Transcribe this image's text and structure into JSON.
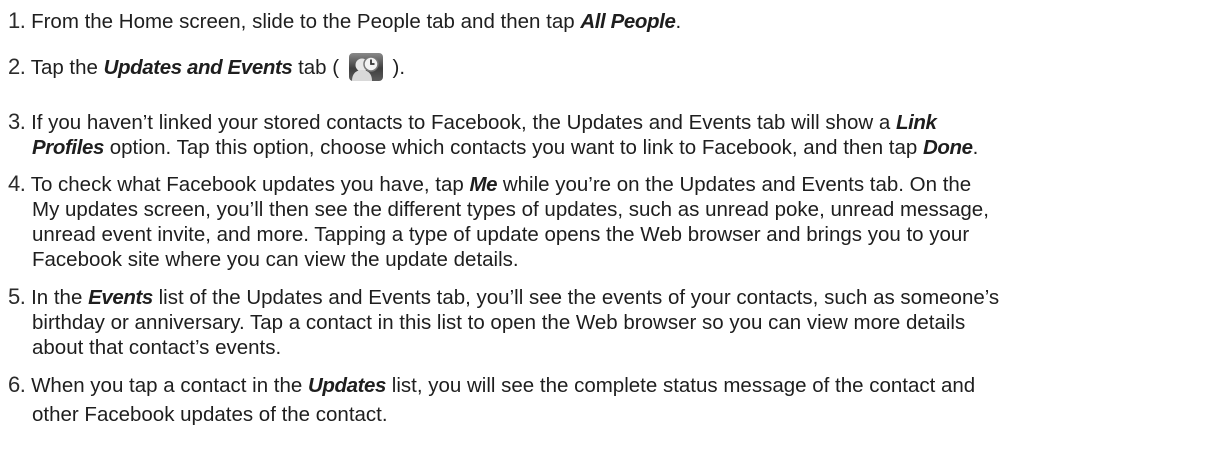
{
  "steps": [
    {
      "number": "1.",
      "parts": [
        "From the Home screen, slide to the People tab and then tap ",
        "All People",
        "."
      ]
    },
    {
      "number": "2.",
      "parts": [
        "Tap the ",
        "Updates and Events",
        " tab ( ",
        " )."
      ],
      "icon": "updates-events-tab-icon"
    },
    {
      "number": "3.",
      "lines": [
        [
          "If you haven’t linked your stored contacts to Facebook, the Updates and Events tab will show a ",
          "Link"
        ],
        [
          "Profiles",
          " option. Tap this option, choose which contacts you want to link to Facebook, and then tap ",
          "Done",
          "."
        ]
      ]
    },
    {
      "number": "4.",
      "lines": [
        [
          "To check what Facebook updates you have, tap ",
          "Me",
          " while you’re on the Updates and Events tab. On the"
        ],
        [
          "My updates screen, you’ll then see the different types of updates, such as unread poke, unread message,"
        ],
        [
          "unread event invite, and more. Tapping a type of update opens the Web browser and brings you to your"
        ],
        [
          "Facebook site where you can view the update details."
        ]
      ]
    },
    {
      "number": "5.",
      "lines": [
        [
          "In the ",
          "Events",
          " list of the Updates and Events tab, you’ll see the events of your contacts, such as someone’s"
        ],
        [
          "birthday or anniversary. Tap a contact in this list to open the Web browser so you can view more details"
        ],
        [
          "about that contact’s events."
        ]
      ]
    },
    {
      "number": "6.",
      "lines": [
        [
          "When you tap a contact in the ",
          "Updates",
          " list, you will see the complete status message of the contact and"
        ],
        [
          "other Facebook updates of the contact."
        ]
      ]
    }
  ]
}
